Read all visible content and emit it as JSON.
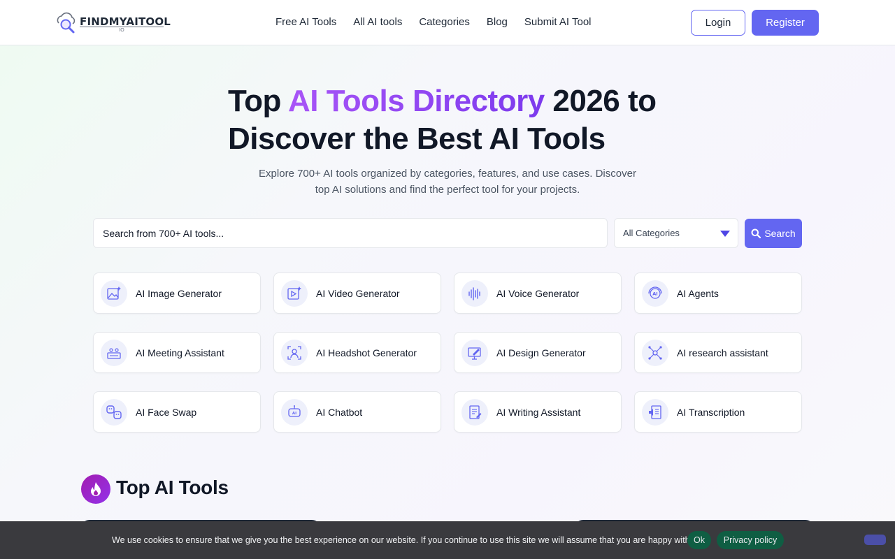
{
  "header": {
    "logo_text": "FINDMYAITOOL",
    "logo_sub": "IO",
    "nav": [
      {
        "label": "Free AI Tools"
      },
      {
        "label": "All AI tools"
      },
      {
        "label": "Categories"
      },
      {
        "label": "Blog"
      },
      {
        "label": "Submit AI Tool"
      }
    ],
    "login_label": "Login",
    "register_label": "Register"
  },
  "hero": {
    "title_part1": "Top ",
    "title_accent": "AI Tools Directory",
    "title_part2": " 2026 to Discover the Best AI Tools",
    "subtitle": "Explore 700+ AI tools organized by categories, features, and use cases. Discover top AI solutions and find the perfect tool for your projects."
  },
  "search": {
    "placeholder": "Search from 700+ AI tools...",
    "category_selected": "All Categories",
    "button_label": "Search"
  },
  "categories": [
    {
      "label": "AI Image Generator",
      "icon": "image-sparkle-icon"
    },
    {
      "label": "AI Video Generator",
      "icon": "video-sparkle-icon"
    },
    {
      "label": "AI Voice Generator",
      "icon": "voice-wave-icon"
    },
    {
      "label": "AI Agents",
      "icon": "agent-headset-icon"
    },
    {
      "label": "AI Meeting Assistant",
      "icon": "meeting-icon"
    },
    {
      "label": "AI Headshot Generator",
      "icon": "headshot-icon"
    },
    {
      "label": "AI Design Generator",
      "icon": "design-monitor-icon"
    },
    {
      "label": "AI research assistant",
      "icon": "research-network-icon"
    },
    {
      "label": "AI Face Swap",
      "icon": "face-swap-icon"
    },
    {
      "label": "AI Chatbot",
      "icon": "chatbot-icon"
    },
    {
      "label": "AI Writing Assistant",
      "icon": "writing-document-icon"
    },
    {
      "label": "AI Transcription",
      "icon": "transcription-icon"
    }
  ],
  "top_tools": {
    "title": "Top AI Tools",
    "icon": "fire-icon"
  },
  "cookie": {
    "message": "We use cookies to ensure that we give you the best experience on our website. If you continue to use this site we will assume that you are happy with it.",
    "ok_label": "Ok",
    "privacy_label": "Privacy policy"
  },
  "colors": {
    "accent": "#6366f1",
    "title_gradient_start": "#a855f7",
    "title_gradient_end": "#7c3aed",
    "cookie_bar": "#3a3a3e",
    "cookie_button": "#0f5e43"
  }
}
